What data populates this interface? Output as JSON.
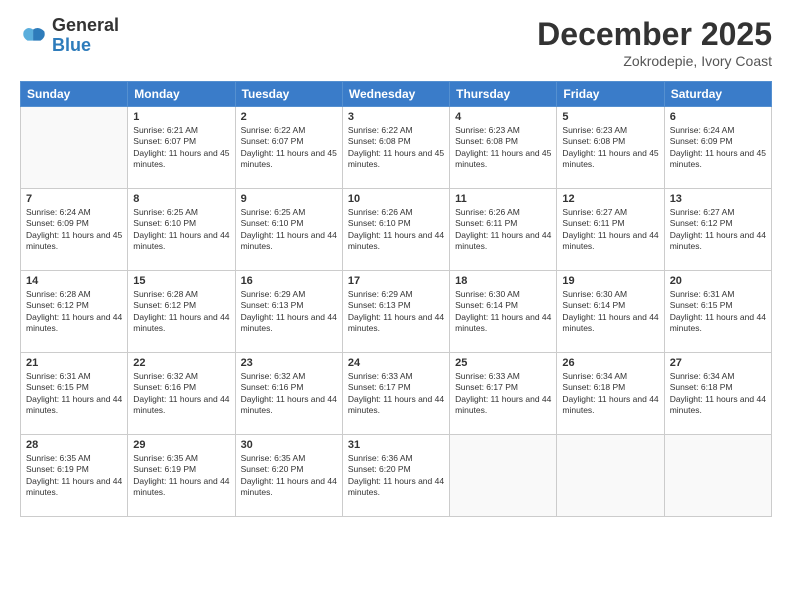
{
  "header": {
    "logo": {
      "general": "General",
      "blue": "Blue"
    },
    "title": "December 2025",
    "location": "Zokrodepie, Ivory Coast"
  },
  "calendar": {
    "days_of_week": [
      "Sunday",
      "Monday",
      "Tuesday",
      "Wednesday",
      "Thursday",
      "Friday",
      "Saturday"
    ],
    "weeks": [
      [
        {
          "day": null
        },
        {
          "day": 1,
          "sunrise": "6:21 AM",
          "sunset": "6:07 PM",
          "daylight": "11 hours and 45 minutes."
        },
        {
          "day": 2,
          "sunrise": "6:22 AM",
          "sunset": "6:07 PM",
          "daylight": "11 hours and 45 minutes."
        },
        {
          "day": 3,
          "sunrise": "6:22 AM",
          "sunset": "6:08 PM",
          "daylight": "11 hours and 45 minutes."
        },
        {
          "day": 4,
          "sunrise": "6:23 AM",
          "sunset": "6:08 PM",
          "daylight": "11 hours and 45 minutes."
        },
        {
          "day": 5,
          "sunrise": "6:23 AM",
          "sunset": "6:08 PM",
          "daylight": "11 hours and 45 minutes."
        },
        {
          "day": 6,
          "sunrise": "6:24 AM",
          "sunset": "6:09 PM",
          "daylight": "11 hours and 45 minutes."
        }
      ],
      [
        {
          "day": 7,
          "sunrise": "6:24 AM",
          "sunset": "6:09 PM",
          "daylight": "11 hours and 45 minutes."
        },
        {
          "day": 8,
          "sunrise": "6:25 AM",
          "sunset": "6:10 PM",
          "daylight": "11 hours and 44 minutes."
        },
        {
          "day": 9,
          "sunrise": "6:25 AM",
          "sunset": "6:10 PM",
          "daylight": "11 hours and 44 minutes."
        },
        {
          "day": 10,
          "sunrise": "6:26 AM",
          "sunset": "6:10 PM",
          "daylight": "11 hours and 44 minutes."
        },
        {
          "day": 11,
          "sunrise": "6:26 AM",
          "sunset": "6:11 PM",
          "daylight": "11 hours and 44 minutes."
        },
        {
          "day": 12,
          "sunrise": "6:27 AM",
          "sunset": "6:11 PM",
          "daylight": "11 hours and 44 minutes."
        },
        {
          "day": 13,
          "sunrise": "6:27 AM",
          "sunset": "6:12 PM",
          "daylight": "11 hours and 44 minutes."
        }
      ],
      [
        {
          "day": 14,
          "sunrise": "6:28 AM",
          "sunset": "6:12 PM",
          "daylight": "11 hours and 44 minutes."
        },
        {
          "day": 15,
          "sunrise": "6:28 AM",
          "sunset": "6:12 PM",
          "daylight": "11 hours and 44 minutes."
        },
        {
          "day": 16,
          "sunrise": "6:29 AM",
          "sunset": "6:13 PM",
          "daylight": "11 hours and 44 minutes."
        },
        {
          "day": 17,
          "sunrise": "6:29 AM",
          "sunset": "6:13 PM",
          "daylight": "11 hours and 44 minutes."
        },
        {
          "day": 18,
          "sunrise": "6:30 AM",
          "sunset": "6:14 PM",
          "daylight": "11 hours and 44 minutes."
        },
        {
          "day": 19,
          "sunrise": "6:30 AM",
          "sunset": "6:14 PM",
          "daylight": "11 hours and 44 minutes."
        },
        {
          "day": 20,
          "sunrise": "6:31 AM",
          "sunset": "6:15 PM",
          "daylight": "11 hours and 44 minutes."
        }
      ],
      [
        {
          "day": 21,
          "sunrise": "6:31 AM",
          "sunset": "6:15 PM",
          "daylight": "11 hours and 44 minutes."
        },
        {
          "day": 22,
          "sunrise": "6:32 AM",
          "sunset": "6:16 PM",
          "daylight": "11 hours and 44 minutes."
        },
        {
          "day": 23,
          "sunrise": "6:32 AM",
          "sunset": "6:16 PM",
          "daylight": "11 hours and 44 minutes."
        },
        {
          "day": 24,
          "sunrise": "6:33 AM",
          "sunset": "6:17 PM",
          "daylight": "11 hours and 44 minutes."
        },
        {
          "day": 25,
          "sunrise": "6:33 AM",
          "sunset": "6:17 PM",
          "daylight": "11 hours and 44 minutes."
        },
        {
          "day": 26,
          "sunrise": "6:34 AM",
          "sunset": "6:18 PM",
          "daylight": "11 hours and 44 minutes."
        },
        {
          "day": 27,
          "sunrise": "6:34 AM",
          "sunset": "6:18 PM",
          "daylight": "11 hours and 44 minutes."
        }
      ],
      [
        {
          "day": 28,
          "sunrise": "6:35 AM",
          "sunset": "6:19 PM",
          "daylight": "11 hours and 44 minutes."
        },
        {
          "day": 29,
          "sunrise": "6:35 AM",
          "sunset": "6:19 PM",
          "daylight": "11 hours and 44 minutes."
        },
        {
          "day": 30,
          "sunrise": "6:35 AM",
          "sunset": "6:20 PM",
          "daylight": "11 hours and 44 minutes."
        },
        {
          "day": 31,
          "sunrise": "6:36 AM",
          "sunset": "6:20 PM",
          "daylight": "11 hours and 44 minutes."
        },
        {
          "day": null
        },
        {
          "day": null
        },
        {
          "day": null
        }
      ]
    ]
  }
}
